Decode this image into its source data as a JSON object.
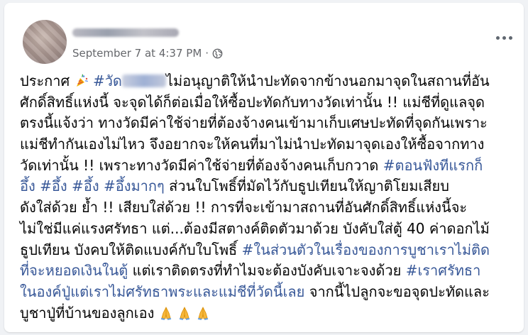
{
  "post": {
    "date": "September 7 at 4:37 PM",
    "separator": "·",
    "lines": [
      [
        "ประกาศ",
        "#วัด",
        "ไม่อนุญาติให้นำปะทัดจากข้างนอกมาจุดในสถานที่อัน"
      ],
      [
        "ศักดิ์สิทธิ์แห่งนี้ จะจุดได้ก็ต่อเมื่อให้ซื้อปะทัดกับทางวัดเท่านั้น !! แม่ชีที่ดูแลจุด"
      ],
      [
        "ตรงนี้แจ้งว่า ทางวัดมีค่าใช้จ่ายที่ต้องจ้างคนเข้ามาเก็บเศษปะทัดที่จุดกันเพราะ"
      ],
      [
        "แม่ชีทำกันเองไม่ไหว จึงอยากจะให้คนที่มาไม่นำปะทัดมาจุดเองให้ซื้อจากทาง"
      ],
      [
        "วัดเท่านั้น !! เพราะทางวัดมีค่าใช้จ่ายที่ต้องจ้างคนเก็บกวาด",
        "#ตอนฟังทีแรกก็"
      ],
      [
        "อึ้ง",
        "#อึ้ง",
        "#อึ้ง",
        "#อึ้งมากๆ",
        "ส่วนใบโพธิ์ที่มัดไว้กับธูปเทียนให้ญาติโยมเสียบ"
      ],
      [
        "ดังใส่ด้วย ย้ำ !! เสียบใส่ด้วย !! การที่จะเข้ามาสถานที่อันศักดิ์สิทธิ์แห่งนี้จะ"
      ],
      [
        "ไม่ใช่มีแค่แรงศรัทธา แต่...ต้องมีสตางค์ติดตัวมาด้วย บังคับใส่ตู้ 40 ค่าดอกไม้"
      ],
      [
        "ธูปเทียน บังคบให้ติดแบงค์กับใบโพธิ์",
        "#ในส่วนตัวในเรื่องของการบูชาเราไม่ติด"
      ],
      [
        "ที่จะหยอดเงินในตู้",
        "แต่เราติดตรงที่ทำไมจะต้องบังคับเจาะจงด้วย",
        "#เราศรัทธา"
      ],
      [
        "ในองค์ปู่แต่เราไม่ศรัทธาพระและแม่ชีที่วัดนี้เลย",
        "จากนี้ไปลูกจะขอจุดปะทัดและ"
      ],
      [
        "บูชาปู่ที่บ้านของลูกเอง"
      ]
    ]
  },
  "icons": {
    "party": "party-popper-icon",
    "globe": "globe-icon",
    "more": "more-options-icon",
    "pray": "folded-hands-icon"
  },
  "colors": {
    "hashtag": "#385898",
    "meta": "#65676b",
    "text": "#050505"
  }
}
